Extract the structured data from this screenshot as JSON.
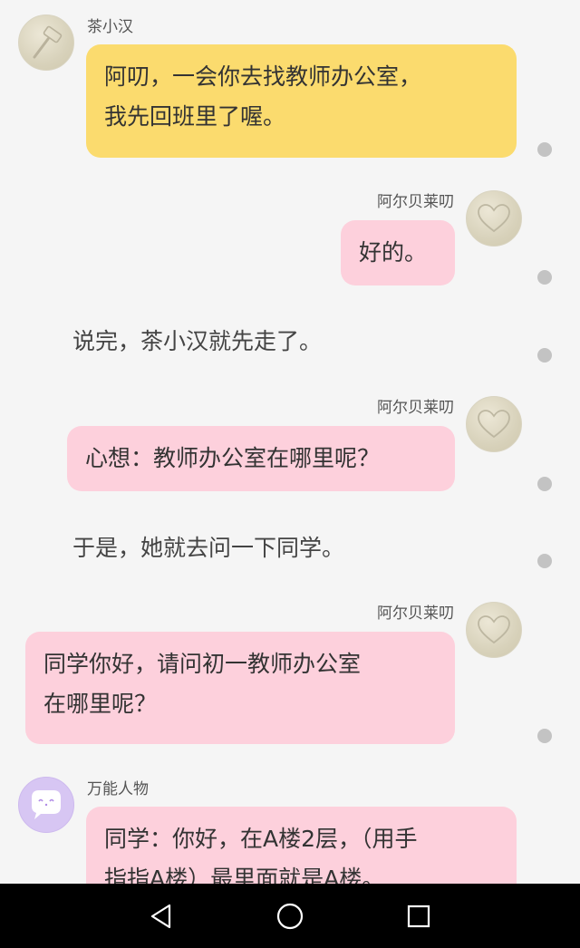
{
  "messages": [
    {
      "speaker": "茶小汉",
      "lines": [
        "阿叨，一会你去找教师办公室，",
        "我先回班里了喔。"
      ]
    },
    {
      "speaker": "阿尔贝莱叨",
      "lines": [
        "好的。"
      ]
    },
    {
      "narration": "说完，茶小汉就先走了。"
    },
    {
      "speaker": "阿尔贝莱叨",
      "lines": [
        "心想：教师办公室在哪里呢？"
      ]
    },
    {
      "narration": "于是，她就去问一下同学。"
    },
    {
      "speaker": "阿尔贝莱叨",
      "lines": [
        "同学你好，请问初一教师办公室",
        "在哪里呢？"
      ]
    },
    {
      "speaker": "万能人物",
      "lines": [
        "同学：你好，在A楼2层，（用手",
        "指指A楼）最里面就是A楼。"
      ]
    }
  ],
  "icons": {
    "hammer": "hammer-icon",
    "heart": "heart-icon",
    "chat": "chat-bubble-icon",
    "back": "back-triangle-icon",
    "home": "home-circle-icon",
    "recent": "recent-square-icon"
  },
  "colors": {
    "yellow_bubble": "#fbdb6e",
    "pink_bubble": "#fdd0dc",
    "background": "#f5f5f5",
    "navbar": "#000000"
  }
}
